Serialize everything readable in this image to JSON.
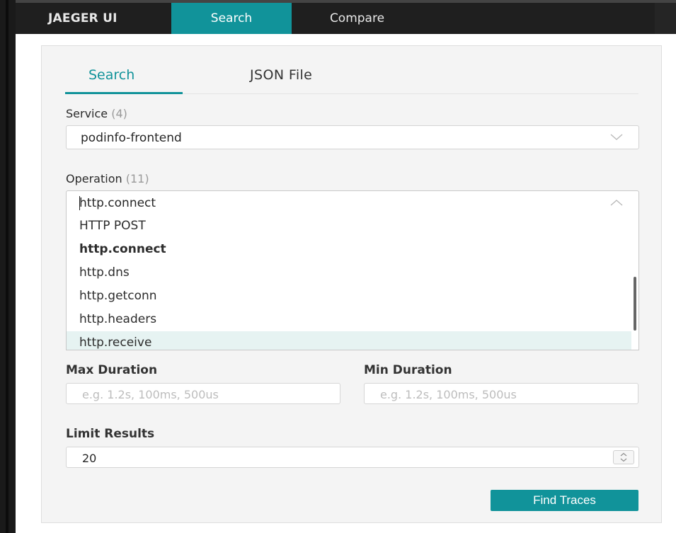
{
  "topnav": {
    "brand": "JAEGER UI",
    "items": [
      {
        "label": "Search",
        "active": true
      },
      {
        "label": "Compare",
        "active": false
      }
    ]
  },
  "tabs": [
    {
      "label": "Search",
      "active": true
    },
    {
      "label": "JSON File",
      "active": false
    }
  ],
  "service": {
    "label": "Service",
    "count": "(4)",
    "value": "podinfo-frontend"
  },
  "operation": {
    "label": "Operation",
    "count": "(11)",
    "value": "http.connect",
    "options": [
      {
        "label": "HTTP POST",
        "selected": false,
        "highlighted": false
      },
      {
        "label": "http.connect",
        "selected": true,
        "highlighted": false
      },
      {
        "label": "http.dns",
        "selected": false,
        "highlighted": false
      },
      {
        "label": "http.getconn",
        "selected": false,
        "highlighted": false
      },
      {
        "label": "http.headers",
        "selected": false,
        "highlighted": false
      },
      {
        "label": "http.receive",
        "selected": false,
        "highlighted": true
      }
    ]
  },
  "max_duration": {
    "label": "Max Duration",
    "placeholder": "e.g. 1.2s, 100ms, 500us"
  },
  "min_duration": {
    "label": "Min Duration",
    "placeholder": "e.g. 1.2s, 100ms, 500us"
  },
  "limit_results": {
    "label": "Limit Results",
    "value": "20"
  },
  "find_button": "Find Traces",
  "colors": {
    "accent": "#11939a",
    "nav_bg": "#1f1f1f",
    "panel_bg": "#f4f4f4",
    "highlight_row": "#e6f3f2"
  },
  "icons": {
    "service_caret": "chevron-down-icon",
    "operation_caret": "chevron-up-icon",
    "stepper": "stepper-arrows-icon"
  }
}
